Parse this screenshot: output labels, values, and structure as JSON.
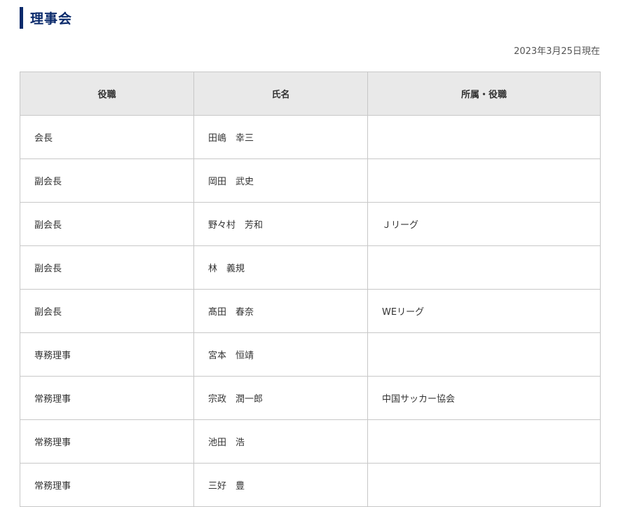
{
  "heading": {
    "title": "理事会",
    "accent_color": "#0a2a6b"
  },
  "date_note": "2023年3月25日現在",
  "table": {
    "headers": [
      "役職",
      "氏名",
      "所属・役職"
    ],
    "rows": [
      {
        "role": "会長",
        "name": "田嶋　幸三",
        "affiliation": ""
      },
      {
        "role": "副会長",
        "name": "岡田　武史",
        "affiliation": ""
      },
      {
        "role": "副会長",
        "name": "野々村　芳和",
        "affiliation": "Ｊリーグ"
      },
      {
        "role": "副会長",
        "name": "林　義規",
        "affiliation": ""
      },
      {
        "role": "副会長",
        "name": "髙田　春奈",
        "affiliation": "WEリーグ"
      },
      {
        "role": "専務理事",
        "name": "宮本　恒靖",
        "affiliation": ""
      },
      {
        "role": "常務理事",
        "name": "宗政　潤一郎",
        "affiliation": "中国サッカー協会"
      },
      {
        "role": "常務理事",
        "name": "池田　浩",
        "affiliation": ""
      },
      {
        "role": "常務理事",
        "name": "三好　豊",
        "affiliation": ""
      }
    ]
  }
}
